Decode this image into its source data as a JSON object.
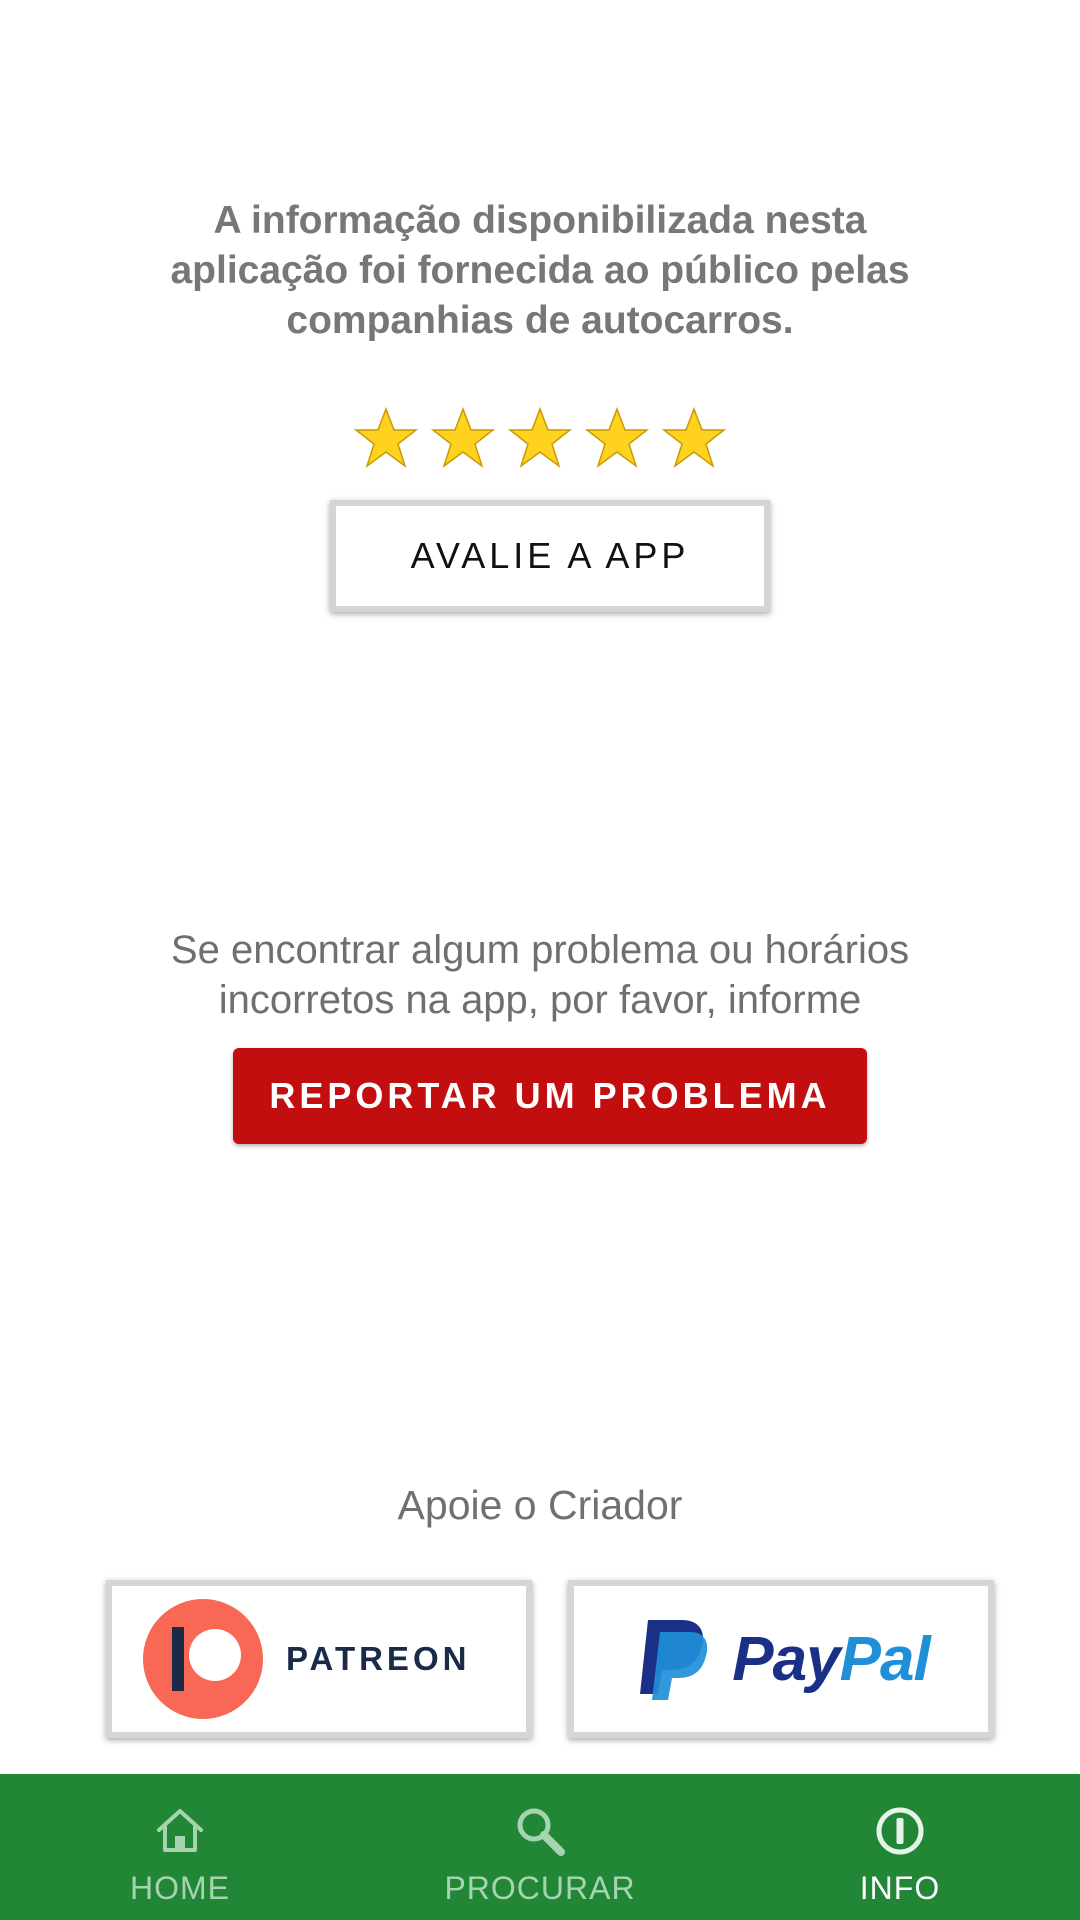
{
  "info": {
    "text": "A informação disponibilizada nesta aplicação foi fornecida ao público pelas companhias de autocarros."
  },
  "rating": {
    "stars": 5,
    "button_label": "AVALIE A APP"
  },
  "report": {
    "text": "Se encontrar algum problema ou horários incorretos na app, por favor, informe",
    "button_label": "REPORTAR UM PROBLEMA"
  },
  "support": {
    "title": "Apoie o Criador",
    "patreon_label": "PATREON",
    "paypal_label_pay": "Pay",
    "paypal_label_pal": "Pal"
  },
  "nav": {
    "items": [
      {
        "label": "HOME",
        "icon": "home-icon",
        "active": false
      },
      {
        "label": "PROCURAR",
        "icon": "search-icon",
        "active": false
      },
      {
        "label": "INFO",
        "icon": "info-icon",
        "active": true
      }
    ]
  },
  "colors": {
    "nav_background": "#218636",
    "report_button": "#c20e0e",
    "star": "#ffd21f",
    "patreon": "#f96854",
    "paypal_dark": "#1a2f86",
    "paypal_light": "#1f8fd8"
  }
}
